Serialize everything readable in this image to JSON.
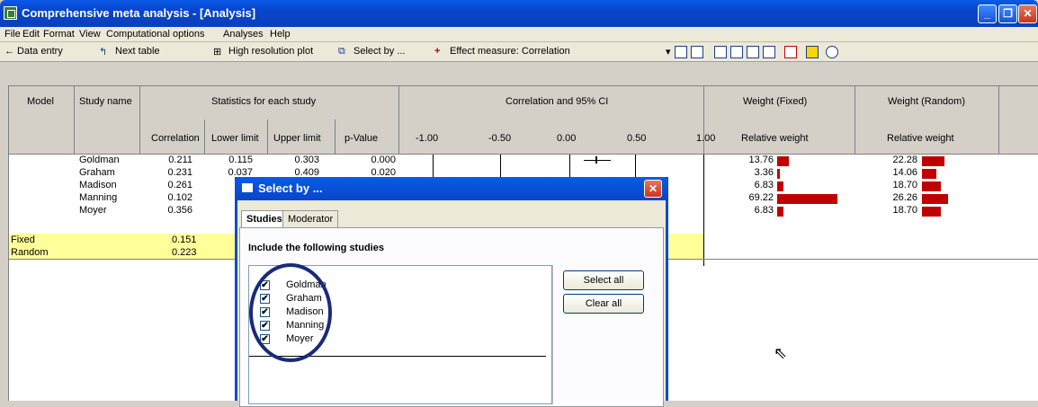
{
  "window": {
    "title": "Comprehensive meta analysis - [Analysis]"
  },
  "menu": [
    "File",
    "Edit",
    "Format",
    "View",
    "Computational options",
    "Analyses",
    "Help"
  ],
  "toolbar": {
    "data_entry": "← Data entry",
    "next_table": "Next table",
    "high_res": "High resolution plot",
    "select_by": "Select by ...",
    "effect": "Effect measure: Correlation"
  },
  "header": {
    "model": "Model",
    "study": "Study name",
    "stats": "Statistics for each study",
    "ci": "Correlation and 95% CI",
    "wfixed": "Weight (Fixed)",
    "wrandom": "Weight (Random)",
    "correlation": "Correlation",
    "lower": "Lower limit",
    "upper": "Upper limit",
    "pvalue": "p-Value",
    "ticks": [
      "-1.00",
      "-0.50",
      "0.00",
      "0.50",
      "1.00"
    ],
    "relw1": "Relative weight",
    "relw2": "Relative weight"
  },
  "rows": [
    {
      "name": "Goldman",
      "corr": "0.211",
      "lower": "0.115",
      "upper": "0.303",
      "p": "0.000",
      "wf": "13.76",
      "wr": "22.28",
      "wfv": 13.76,
      "wrv": 22.28
    },
    {
      "name": "Graham",
      "corr": "0.231",
      "lower": "0.037",
      "upper": "0.409",
      "p": "0.020",
      "wf": "3.36",
      "wr": "14.06",
      "wfv": 3.36,
      "wrv": 14.06
    },
    {
      "name": "Madison",
      "corr": "0.261",
      "lower": "",
      "upper": "",
      "p": "",
      "wf": "6.83",
      "wr": "18.70",
      "wfv": 6.83,
      "wrv": 18.7
    },
    {
      "name": "Manning",
      "corr": "0.102",
      "lower": "",
      "upper": "",
      "p": "",
      "wf": "69.22",
      "wr": "26.26",
      "wfv": 69.22,
      "wrv": 26.26
    },
    {
      "name": "Moyer",
      "corr": "0.356",
      "lower": "",
      "upper": "",
      "p": "",
      "wf": "6.83",
      "wr": "18.70",
      "wfv": 6.83,
      "wrv": 18.7
    }
  ],
  "summary": [
    {
      "model": "Fixed",
      "corr": "0.151"
    },
    {
      "model": "Random",
      "corr": "0.223"
    }
  ],
  "dialog": {
    "title": "Select by ...",
    "tab1": "Studies",
    "tab2": "Moderator",
    "instruction": "Include the following studies",
    "select_all": "Select all",
    "clear_all": "Clear all",
    "studies": [
      "Goldman",
      "Graham",
      "Madison",
      "Manning",
      "Moyer"
    ]
  },
  "colors": {
    "bar": "#c00000",
    "highlight": "#ffff99",
    "circle": "#1a2a7a"
  }
}
